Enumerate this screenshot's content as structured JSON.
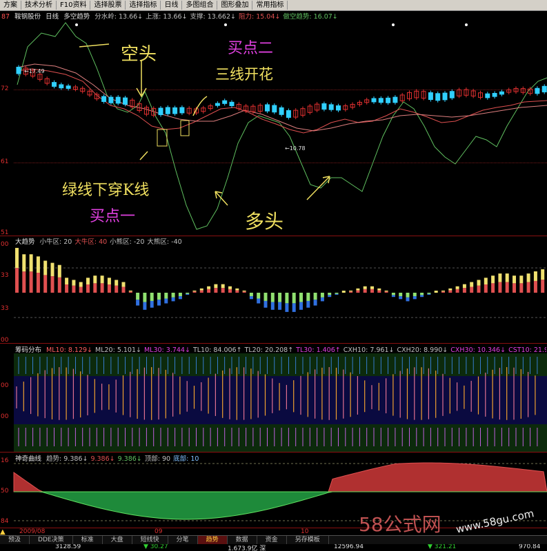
{
  "menubar": {
    "items": [
      "方案",
      "技术分析",
      "F10资料",
      "选择股票",
      "选择指标",
      "日线",
      "多图组合",
      "图形叠加",
      "常用指标"
    ]
  },
  "main_panel": {
    "stock_name": "鞍钢股份",
    "period": "日线",
    "indicator": "多空趋势",
    "values": [
      {
        "label": "分水岭",
        "value": "13.66",
        "arrow": "↓"
      },
      {
        "label": "上涨",
        "value": "13.66",
        "arrow": "↓"
      },
      {
        "label": "支撑",
        "value": "13.662",
        "arrow": "↓"
      },
      {
        "label": "阻力",
        "value": "15.04",
        "arrow": "↓"
      },
      {
        "label": "做空趋势",
        "value": "16.07",
        "arrow": "↓"
      }
    ],
    "y_labels": [
      "87",
      "72",
      "61",
      "51"
    ],
    "price_marks": {
      "high": "17.49",
      "low": "10.78"
    },
    "annotations": {
      "kongtou": "空头",
      "maidian2": "买点二",
      "sanxian": "三线开花",
      "lvxian": "绿线下穿K线",
      "maidian1": "买点一",
      "duotou": "多头"
    }
  },
  "panel2": {
    "title": "大趋势",
    "values": [
      {
        "label": "小牛区",
        "value": "20"
      },
      {
        "label": "大牛区",
        "value": "40"
      },
      {
        "label": "小熊区",
        "value": "-20"
      },
      {
        "label": "大熊区",
        "value": "-40"
      }
    ],
    "y_labels": [
      "00",
      "33",
      "33",
      "00"
    ],
    "series_values": [
      42,
      36,
      36,
      34,
      30,
      28,
      26,
      14,
      12,
      10,
      14,
      16,
      16,
      14,
      12,
      10,
      2,
      -12,
      -16,
      -14,
      -12,
      -10,
      -8,
      -6,
      -2,
      2,
      4,
      6,
      8,
      8,
      6,
      4,
      2,
      -6,
      -10,
      -14,
      -16,
      -16,
      -18,
      -18,
      -16,
      -14,
      -12,
      -8,
      -4,
      -2,
      0,
      2,
      4,
      6,
      6,
      4,
      2,
      -4,
      -6,
      -8,
      -6,
      -4,
      -2,
      0,
      2,
      4,
      6,
      8,
      10,
      12,
      14,
      16,
      18,
      18,
      16,
      16,
      18,
      20,
      22
    ]
  },
  "panel3": {
    "title": "筹码分布",
    "values": [
      {
        "label": "ML10",
        "value": "8.129",
        "arrow": "↓"
      },
      {
        "label": "ML20",
        "value": "5.101",
        "arrow": "↓"
      },
      {
        "label": "ML30",
        "value": "3.744",
        "arrow": "↓"
      },
      {
        "label": "TL10",
        "value": "84.006",
        "arrow": "↑"
      },
      {
        "label": "TL20",
        "value": "20.208",
        "arrow": "↑"
      },
      {
        "label": "TL30",
        "value": "1.406",
        "arrow": "↑"
      },
      {
        "label": "CXH10",
        "value": "7.961",
        "arrow": "↓"
      },
      {
        "label": "CXH20",
        "value": "8.990",
        "arrow": "↓"
      },
      {
        "label": "CXH30",
        "value": "10.346",
        "arrow": "↓"
      },
      {
        "label": "CST10",
        "value": "21.90",
        "arrow": ""
      }
    ],
    "y_labels": [
      "00",
      "00"
    ]
  },
  "panel4": {
    "title": "神奇曲线",
    "values": [
      {
        "label": "趋势",
        "value": "9.386",
        "arrow": "↓"
      },
      {
        "label": "",
        "value": "9.386",
        "arrow": "↓"
      },
      {
        "label": "",
        "value": "9.386",
        "arrow": "↓"
      },
      {
        "label": "顶部",
        "value": "90",
        "arrow": ""
      },
      {
        "label": "底部",
        "value": "10",
        "arrow": ""
      }
    ],
    "y_labels": [
      "16",
      "50",
      "84"
    ]
  },
  "x_axis": {
    "labels": [
      "2009/08",
      "09",
      "10"
    ]
  },
  "bottom_tabs": [
    "预汲",
    "DDE决策",
    "标准",
    "大盘",
    "短线快",
    "分笔",
    "趋势",
    "数据",
    "资金",
    "另存模板"
  ],
  "active_tab": "趋势",
  "ticker": [
    {
      "value": "3128.59"
    },
    {
      "value": "▼ 30.27"
    },
    {
      "value": "1.673.9亿 深"
    },
    {
      "value": "12596.94"
    },
    {
      "value": "▼ 321.21"
    },
    {
      "value": "970.84"
    }
  ],
  "watermark": {
    "text": "58公式网",
    "url": "www.58gu.com"
  },
  "colors": {
    "up_candle": "#e03030",
    "down_candle": "#30d0ff",
    "green_line": "#60c060",
    "red_line": "#e05050",
    "pink_line": "#e08080",
    "annotation_yellow": "#f0e060",
    "annotation_magenta": "#e040e0",
    "bar_red": "#e05050",
    "bar_yellow": "#f0e070",
    "bar_green": "#90e070",
    "bar_blue": "#3070e0"
  }
}
